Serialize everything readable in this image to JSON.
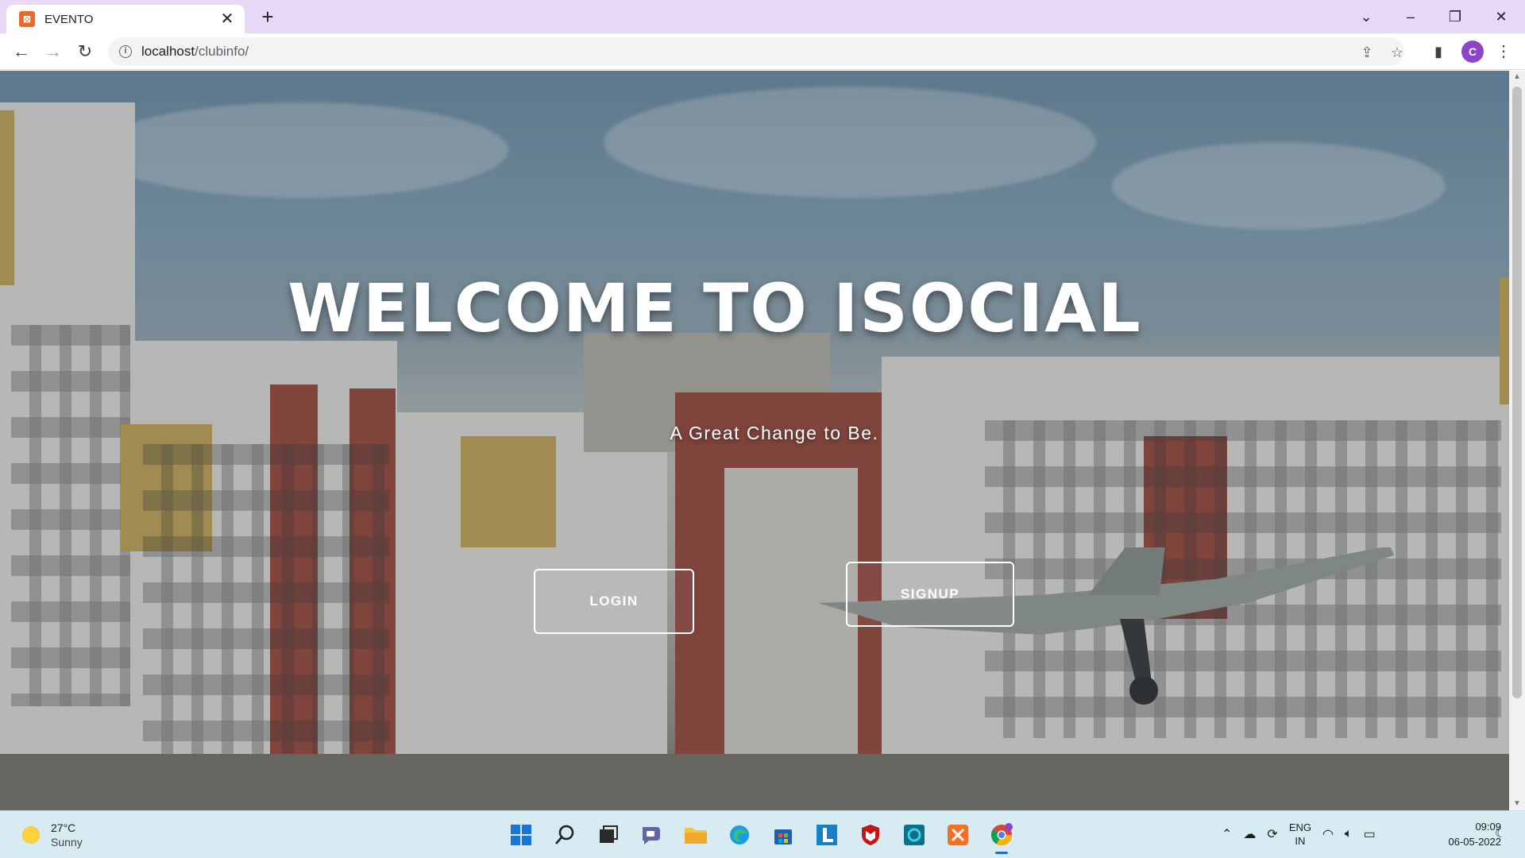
{
  "browser": {
    "tab_title": "EVENTO",
    "tab_close": "✕",
    "new_tab": "+",
    "url_host": "localhost",
    "url_path": "/clubinfo/",
    "profile_initial": "C"
  },
  "page": {
    "hero_title": "WELCOME TO ISOCIAL",
    "hero_subtitle": "A Great Change to Be.",
    "login_label": "LOGIN",
    "signup_label": "SIGNUP"
  },
  "taskbar": {
    "weather_temp": "27°C",
    "weather_condition": "Sunny",
    "language_line1": "ENG",
    "language_line2": "IN",
    "time": "09:09",
    "date": "06-05-2022",
    "pinned_apps": [
      "start-icon",
      "search-icon",
      "task-view-icon",
      "teams-chat-icon",
      "file-explorer-icon",
      "edge-icon",
      "store-icon",
      "l-app-icon",
      "mcafee-icon",
      "o-app-icon",
      "xampp-icon",
      "chrome-icon"
    ]
  },
  "colors": {
    "titlebar": "#e8d8f7",
    "taskbar": "#d6ecf2",
    "avatar": "#8e44c9"
  }
}
